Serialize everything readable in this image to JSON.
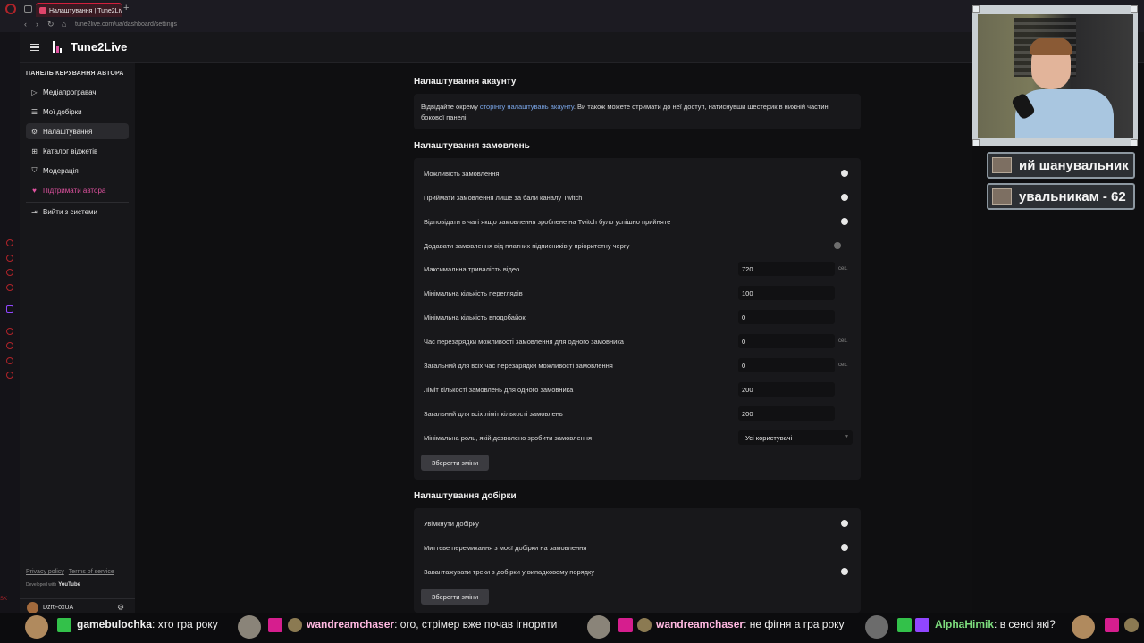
{
  "browser": {
    "tab_title": "Налаштування | Tune2Live",
    "url": "tune2live.com/ua/dashboard/settings",
    "new_tab": "+"
  },
  "header": {
    "app_name": "Tune2Live"
  },
  "sidebar": {
    "heading": "ПАНЕЛЬ КЕРУВАННЯ АВТОРА",
    "items": [
      {
        "label": "Медіапрогравач",
        "icon": "play-icon"
      },
      {
        "label": "Мої добірки",
        "icon": "list-icon"
      },
      {
        "label": "Налаштування",
        "icon": "gear-icon",
        "active": true
      },
      {
        "label": "Каталог віджетів",
        "icon": "grid-icon"
      },
      {
        "label": "Модерація",
        "icon": "shield-icon"
      },
      {
        "label": "Підтримати автора",
        "icon": "heart-icon",
        "accent": "#e052a0"
      },
      {
        "label": "Вийти з системи",
        "icon": "logout-icon"
      }
    ],
    "footer": {
      "privacy": "Privacy policy",
      "terms": "Terms of service",
      "developed_with": "Developed with",
      "youtube": "YouTube"
    },
    "user": {
      "name": "DzrtFoxUA"
    }
  },
  "account": {
    "title": "Налаштування акаунту",
    "text_before": "Відвідайте окрему ",
    "link": "сторінку налаштувань акаунту",
    "text_after": ". Ви також можете отримати до неї доступ, натиснувши шестерик в нижній частині бокової панелі"
  },
  "orders": {
    "title": "Налаштування замовлень",
    "toggles": [
      {
        "label": "Можливість замовлення",
        "on": true
      },
      {
        "label": "Приймати замовлення лише за бали каналу Twitch",
        "on": true
      },
      {
        "label": "Відповідати в чаті якщо замовлення зроблене на Twitch було успішно прийняте",
        "on": true
      },
      {
        "label": "Додавати замовлення від платних підписників у пріоритетну чергу",
        "on": false
      }
    ],
    "fields": [
      {
        "label": "Максимальна тривалість відео",
        "value": "720",
        "unit": "сек."
      },
      {
        "label": "Мінімальна кількість переглядів",
        "value": "100",
        "unit": ""
      },
      {
        "label": "Мінімальна кількість вподобайок",
        "value": "0",
        "unit": ""
      },
      {
        "label": "Час перезарядки можливості замовлення для одного замовника",
        "value": "0",
        "unit": "сек."
      },
      {
        "label": "Загальний для всіх час перезарядки можливості замовлення",
        "value": "0",
        "unit": "сек."
      },
      {
        "label": "Ліміт кількості замовлень для одного замовника",
        "value": "200",
        "unit": ""
      },
      {
        "label": "Загальний для всіх ліміт кількості замовлень",
        "value": "200",
        "unit": ""
      }
    ],
    "role": {
      "label": "Мінімальна роль, якій дозволено зробити замовлення",
      "value": "Усі користувачі"
    },
    "save": "Зберегти зміни"
  },
  "playlist": {
    "title": "Налаштування добірки",
    "toggles": [
      {
        "label": "Увімкнути добірку",
        "on": true
      },
      {
        "label": "Миттєве перемикання з моєї добірки на замовлення",
        "on": true
      },
      {
        "label": "Завантажувати треки з добірки у випадковому порядку",
        "on": true
      }
    ],
    "save": "Зберегти зміни"
  },
  "overlay": {
    "alert1": "ий шанувальник",
    "alert2": "увальникам - 62"
  },
  "chat": [
    {
      "name": "gamebulochka",
      "message": "хто гра року"
    },
    {
      "name": "wandreamchaser",
      "message": "ого, стрімер вже почав ігнорити"
    },
    {
      "name": "wandreamchaser",
      "message": "не фігня а гра року"
    },
    {
      "name": "AlphaHimik",
      "message": "в сенсі які?"
    }
  ],
  "colors": {
    "accent": "#d21f3c",
    "pink": "#e052a0",
    "link": "#7aa6e8"
  }
}
